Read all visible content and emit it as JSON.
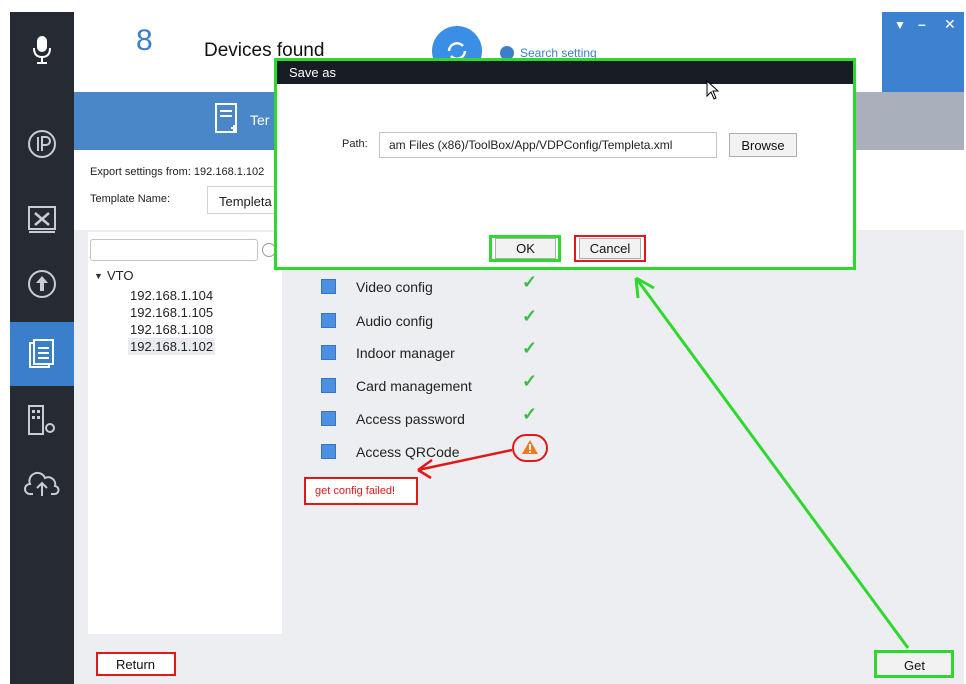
{
  "header": {
    "device_count": "8",
    "devices_found_label": "Devices found",
    "search_setting_label": "Search setting"
  },
  "toolbar": {
    "template_tab_label": "Ter"
  },
  "form": {
    "export_label": "Export settings from: 192.168.1.102",
    "template_name_label": "Template Name:",
    "template_name_value": "Templeta"
  },
  "tree": {
    "search_value": "",
    "root_label": "VTO",
    "items": [
      "192.168.1.104",
      "192.168.1.105",
      "192.168.1.108",
      "192.168.1.102"
    ]
  },
  "config_items": [
    {
      "label": "Video config",
      "status": "ok"
    },
    {
      "label": "Audio config",
      "status": "ok"
    },
    {
      "label": "Indoor manager",
      "status": "ok"
    },
    {
      "label": "Card management",
      "status": "ok"
    },
    {
      "label": "Access password",
      "status": "ok"
    },
    {
      "label": "Access QRCode",
      "status": "warning"
    }
  ],
  "error_message": "get config failed!",
  "dialog": {
    "title": "Save as",
    "path_label": "Path:",
    "path_value": "am Files (x86)/ToolBox/App/VDPConfig/Templeta.xml",
    "browse_label": "Browse",
    "ok_label": "OK",
    "cancel_label": "Cancel"
  },
  "footer": {
    "return_label": "Return",
    "get_label": "Get"
  },
  "colors": {
    "sidebar": "#262a33",
    "accent_blue": "#3b7ec9",
    "highlight_green": "#2fd82f",
    "highlight_red": "#e01818",
    "check_green": "#3bbf3b",
    "warning_orange": "#f07a1a"
  }
}
